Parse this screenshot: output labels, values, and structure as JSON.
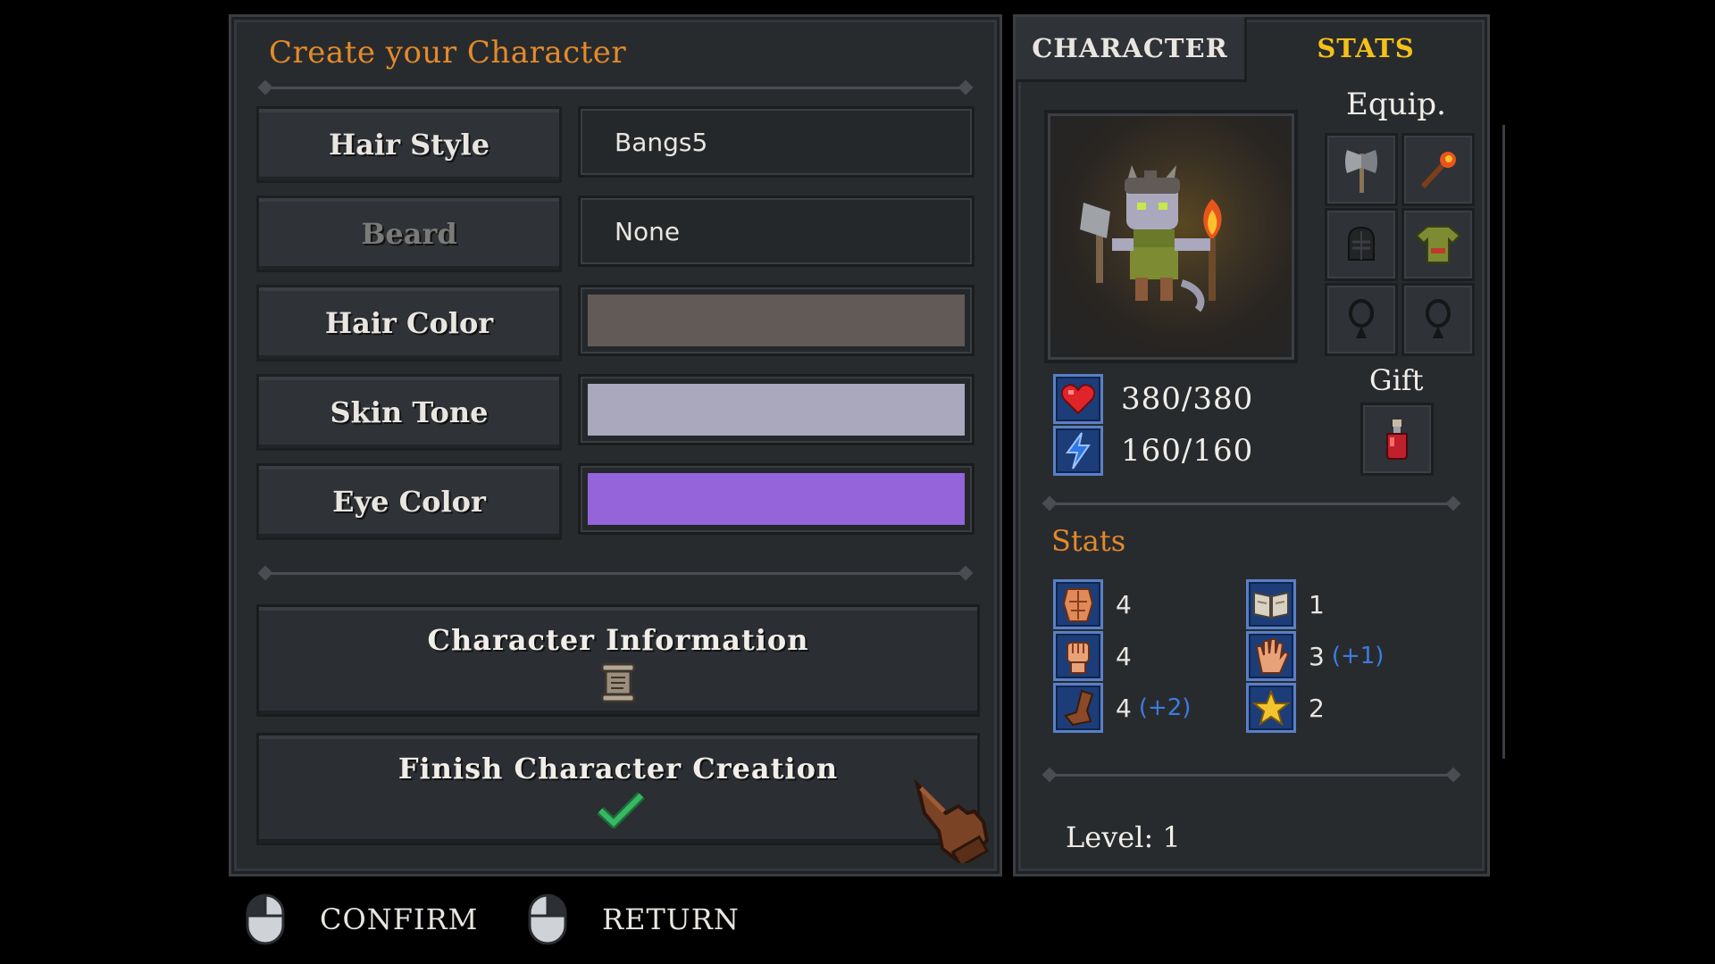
{
  "creator": {
    "title": "Create your Character",
    "rows": [
      {
        "label": "Hair Style",
        "value": "Bangs5",
        "type": "text",
        "disabled": false
      },
      {
        "label": "Beard",
        "value": "None",
        "type": "text",
        "disabled": true
      },
      {
        "label": "Hair Color",
        "value": "",
        "type": "color",
        "color": "#615a56",
        "disabled": false
      },
      {
        "label": "Skin Tone",
        "value": "",
        "type": "color",
        "color": "#a9a8bd",
        "disabled": false
      },
      {
        "label": "Eye Color",
        "value": "",
        "type": "color",
        "color": "#9564db",
        "disabled": false
      }
    ],
    "info_button": "Character Information",
    "finish_button": "Finish Character Creation"
  },
  "tabs": {
    "character": "CHARACTER",
    "stats": "STATS",
    "active": "STATS",
    "active_color": "#f3c11a"
  },
  "equip": {
    "title": "Equip.",
    "slots": [
      "axe-icon",
      "torch-icon",
      "helmet-icon",
      "tunic-icon",
      "amulet-icon",
      "amulet-icon"
    ]
  },
  "vitals": {
    "health": "380/380",
    "mana": "160/160"
  },
  "gift": {
    "title": "Gift",
    "item": "potion-icon"
  },
  "stats": {
    "title": "Stats",
    "left": [
      {
        "icon": "strength-icon",
        "value": "4",
        "bonus": ""
      },
      {
        "icon": "fist-icon",
        "value": "4",
        "bonus": ""
      },
      {
        "icon": "boot-icon",
        "value": "4",
        "bonus": "(+2)"
      }
    ],
    "right": [
      {
        "icon": "book-icon",
        "value": "1",
        "bonus": ""
      },
      {
        "icon": "hand-icon",
        "value": "3",
        "bonus": "(+1)"
      },
      {
        "icon": "star-icon",
        "value": "2",
        "bonus": ""
      }
    ]
  },
  "level": "Level: 1",
  "footer": {
    "confirm": "CONFIRM",
    "return": "RETURN"
  }
}
